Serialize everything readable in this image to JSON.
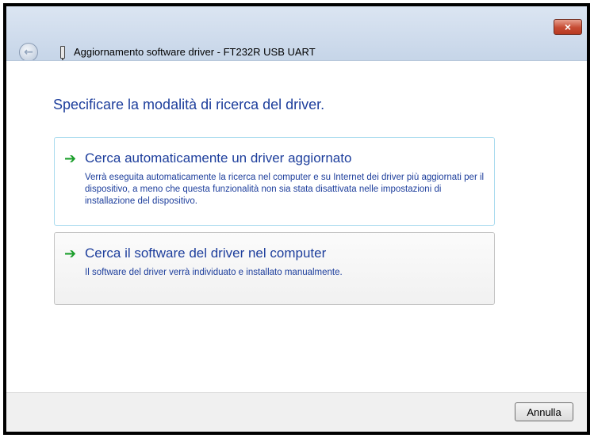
{
  "window": {
    "title": "Aggiornamento software driver - FT232R USB UART",
    "close_label": "×",
    "back_label": "←"
  },
  "content": {
    "heading": "Specificare la modalità di ricerca del driver.",
    "options": [
      {
        "title": "Cerca automaticamente un driver aggiornato",
        "description": "Verrà eseguita automaticamente la ricerca nel computer e su Internet dei driver più aggiornati per il dispositivo, a meno che questa funzionalità non sia stata disattivata nelle impostazioni di installazione del dispositivo.",
        "icon": "green-arrow-icon"
      },
      {
        "title": "Cerca il software del driver nel computer",
        "description": "Il software del driver verrà individuato e installato manualmente.",
        "icon": "green-arrow-icon"
      }
    ]
  },
  "footer": {
    "cancel_label": "Annulla"
  },
  "colors": {
    "link_blue": "#1d3e9c",
    "arrow_green": "#1a9e2a",
    "highlight_border": "#a9dbee"
  }
}
